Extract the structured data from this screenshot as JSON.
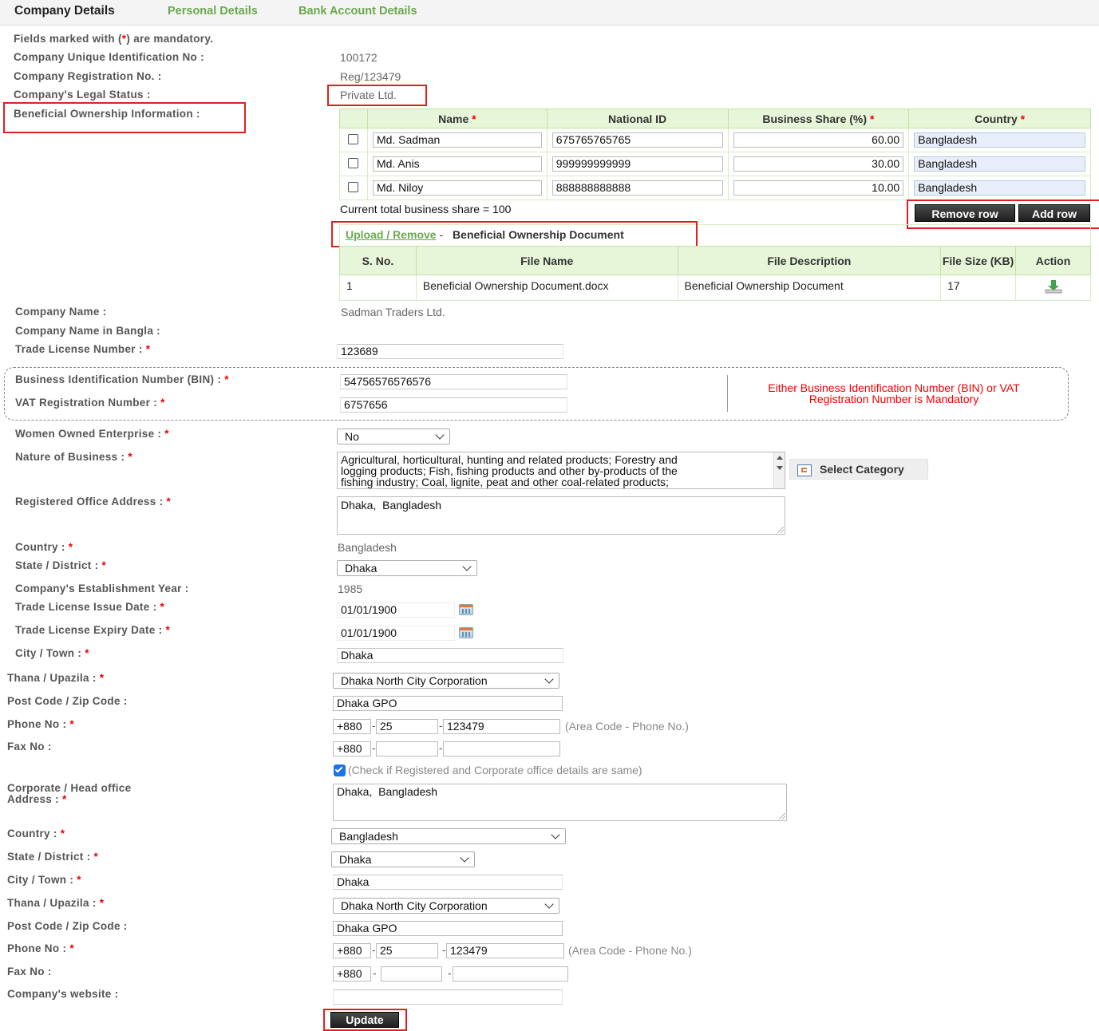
{
  "tabs": [
    "Company Details",
    "Personal Details",
    "Bank Account Details"
  ],
  "mandatory_note": {
    "prefix": "Fields marked with (",
    "star": "*",
    "suffix": ") are mandatory."
  },
  "company_uid": {
    "label": "Company Unique Identification No :",
    "value": "100172"
  },
  "company_reg": {
    "label": "Company Registration No. :",
    "value": "Reg/123479"
  },
  "legal_status": {
    "label": "Company's Legal Status :",
    "value": "Private Ltd."
  },
  "beneficial": {
    "label": "Beneficial Ownership Information :",
    "headers": {
      "name": "Name",
      "national_id": "National ID",
      "share": "Business Share (%)",
      "country": "Country"
    },
    "rows": [
      {
        "name": "Md. Sadman",
        "national_id": "675765765765",
        "share": "60.00",
        "country": "Bangladesh"
      },
      {
        "name": "Md. Anis",
        "national_id": "999999999999",
        "share": "30.00",
        "country": "Bangladesh"
      },
      {
        "name": "Md. Niloy",
        "national_id": "888888888888",
        "share": "10.00",
        "country": "Bangladesh"
      }
    ],
    "total": "Current total business share = 100",
    "remove_row": "Remove row",
    "add_row": "Add row",
    "upload_link": "Upload / Remove",
    "upload_sep": "-",
    "upload_doc": "Beneficial Ownership Document",
    "file_headers": {
      "sno": "S. No.",
      "file_name": "File Name",
      "file_desc": "File Description",
      "file_size": "File Size (KB)",
      "action": "Action"
    },
    "files": [
      {
        "sno": "1",
        "file_name": "Beneficial Ownership Document.docx",
        "file_desc": "Beneficial Ownership Document",
        "file_size": "17"
      }
    ]
  },
  "company_name": {
    "label": "Company Name :",
    "value": "Sadman Traders Ltd."
  },
  "company_name_bangla": {
    "label": "Company Name in Bangla :"
  },
  "trade_license": {
    "label": "Trade License Number :",
    "value": "123689"
  },
  "bin": {
    "label": "Business Identification Number (BIN) :",
    "value": "54756576576576"
  },
  "vat": {
    "label": "VAT Registration Number :",
    "value": "6757656"
  },
  "bin_vat_note": "Either Business Identification Number (BIN) or VAT Registration Number is Mandatory",
  "women_owned": {
    "label": "Women Owned Enterprise :",
    "value": "No"
  },
  "nature_business": {
    "label": "Nature of Business :",
    "lines": [
      "Agricultural, horticultural, hunting and related products; Forestry and",
      "logging products; Fish, fishing products and other by-products of the",
      "fishing industry; Coal, lignite, peat and other coal-related products;"
    ],
    "select_category": "Select Category"
  },
  "reg_address": {
    "label": "Registered Office Address :",
    "value": "Dhaka,  Bangladesh"
  },
  "country1": {
    "label": "Country :",
    "value": "Bangladesh"
  },
  "state1": {
    "label": "State / District :",
    "value": "Dhaka"
  },
  "est_year": {
    "label": "Company's Establishment Year :",
    "value": "1985"
  },
  "issue_date": {
    "label": "Trade License Issue Date :",
    "value": "01/01/1900"
  },
  "expiry_date": {
    "label": "Trade License Expiry Date :",
    "value": "01/01/1900"
  },
  "city1": {
    "label": "City / Town :",
    "value": "Dhaka"
  },
  "thana1": {
    "label": "Thana / Upazila :",
    "value": "Dhaka North City Corporation"
  },
  "post1": {
    "label": "Post Code / Zip Code :",
    "value": "Dhaka GPO"
  },
  "phone1": {
    "label": "Phone No :",
    "code": "+880",
    "area": "25",
    "number": "123479",
    "hint": "(Area Code - Phone No.)"
  },
  "fax1": {
    "label": "Fax No :",
    "code": "+880",
    "area": "",
    "number": ""
  },
  "same_check": "(Check if Registered and Corporate office details are same)",
  "corp_address": {
    "label_line1": "Corporate / Head office",
    "label_line2": "Address :",
    "value": "Dhaka,  Bangladesh"
  },
  "country2": {
    "label": "Country :",
    "value": "Bangladesh"
  },
  "state2": {
    "label": "State / District :",
    "value": "Dhaka"
  },
  "city2": {
    "label": "City / Town :",
    "value": "Dhaka"
  },
  "thana2": {
    "label": "Thana / Upazila :",
    "value": "Dhaka North City Corporation"
  },
  "post2": {
    "label": "Post Code / Zip Code :",
    "value": "Dhaka GPO"
  },
  "phone2": {
    "label": "Phone No :",
    "code": "+880",
    "area": "25",
    "number": "123479",
    "hint": "(Area Code - Phone No.)"
  },
  "fax2": {
    "label": "Fax No :",
    "code": "+880",
    "area": "",
    "number": ""
  },
  "website": {
    "label": "Company's website :",
    "value": ""
  },
  "update_button": "Update",
  "colors": {
    "tab_green": "#6aa84f",
    "header_green": "#e7f6d9",
    "highlight_red": "#e02020",
    "required_red": "#ee0000"
  }
}
